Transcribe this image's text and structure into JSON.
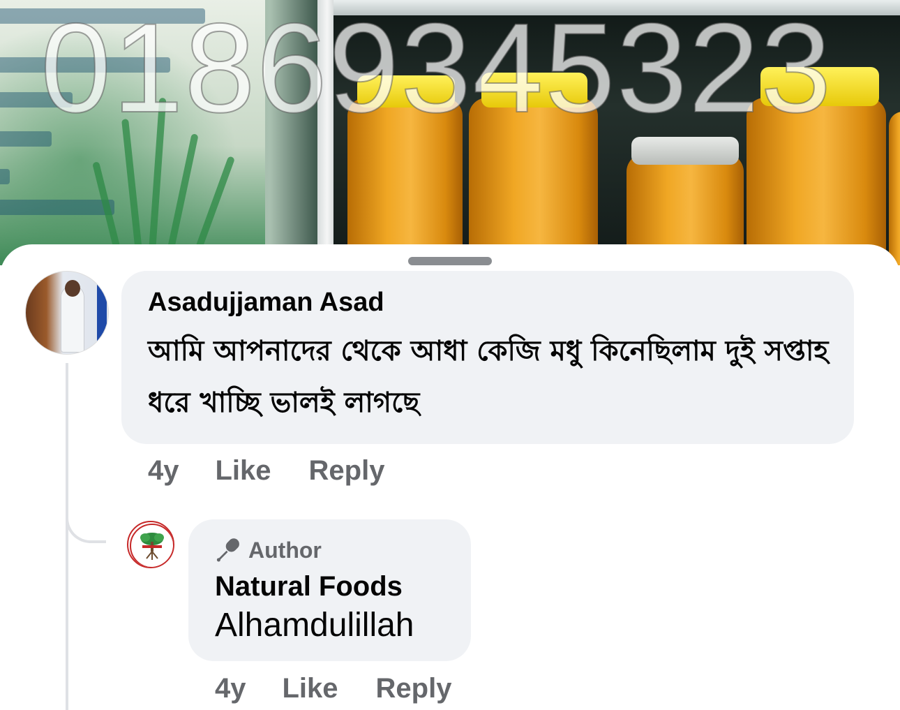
{
  "video": {
    "watermark_phone": "01869345323"
  },
  "comments": [
    {
      "author": "Asadujjaman Asad",
      "text": "আমি আপনাদের থেকে আধা কেজি মধু কিনেছিলাম দুই সপ্তাহ ধরে খাচ্ছি ভালই লাগছে",
      "time": "4y",
      "like_label": "Like",
      "reply_label": "Reply",
      "replies": [
        {
          "badge_label": "Author",
          "badge_icon": "microphone-icon",
          "author": "Natural Foods",
          "text": "Alhamdulillah",
          "time": "4y",
          "like_label": "Like",
          "reply_label": "Reply"
        }
      ]
    }
  ],
  "colors": {
    "bubble": "#f0f2f5",
    "meta_text": "#65676b",
    "primary_text": "#050505",
    "thread_line": "#dfe1e5",
    "honey": "#f0a724",
    "lid": "#f2dd2a"
  }
}
